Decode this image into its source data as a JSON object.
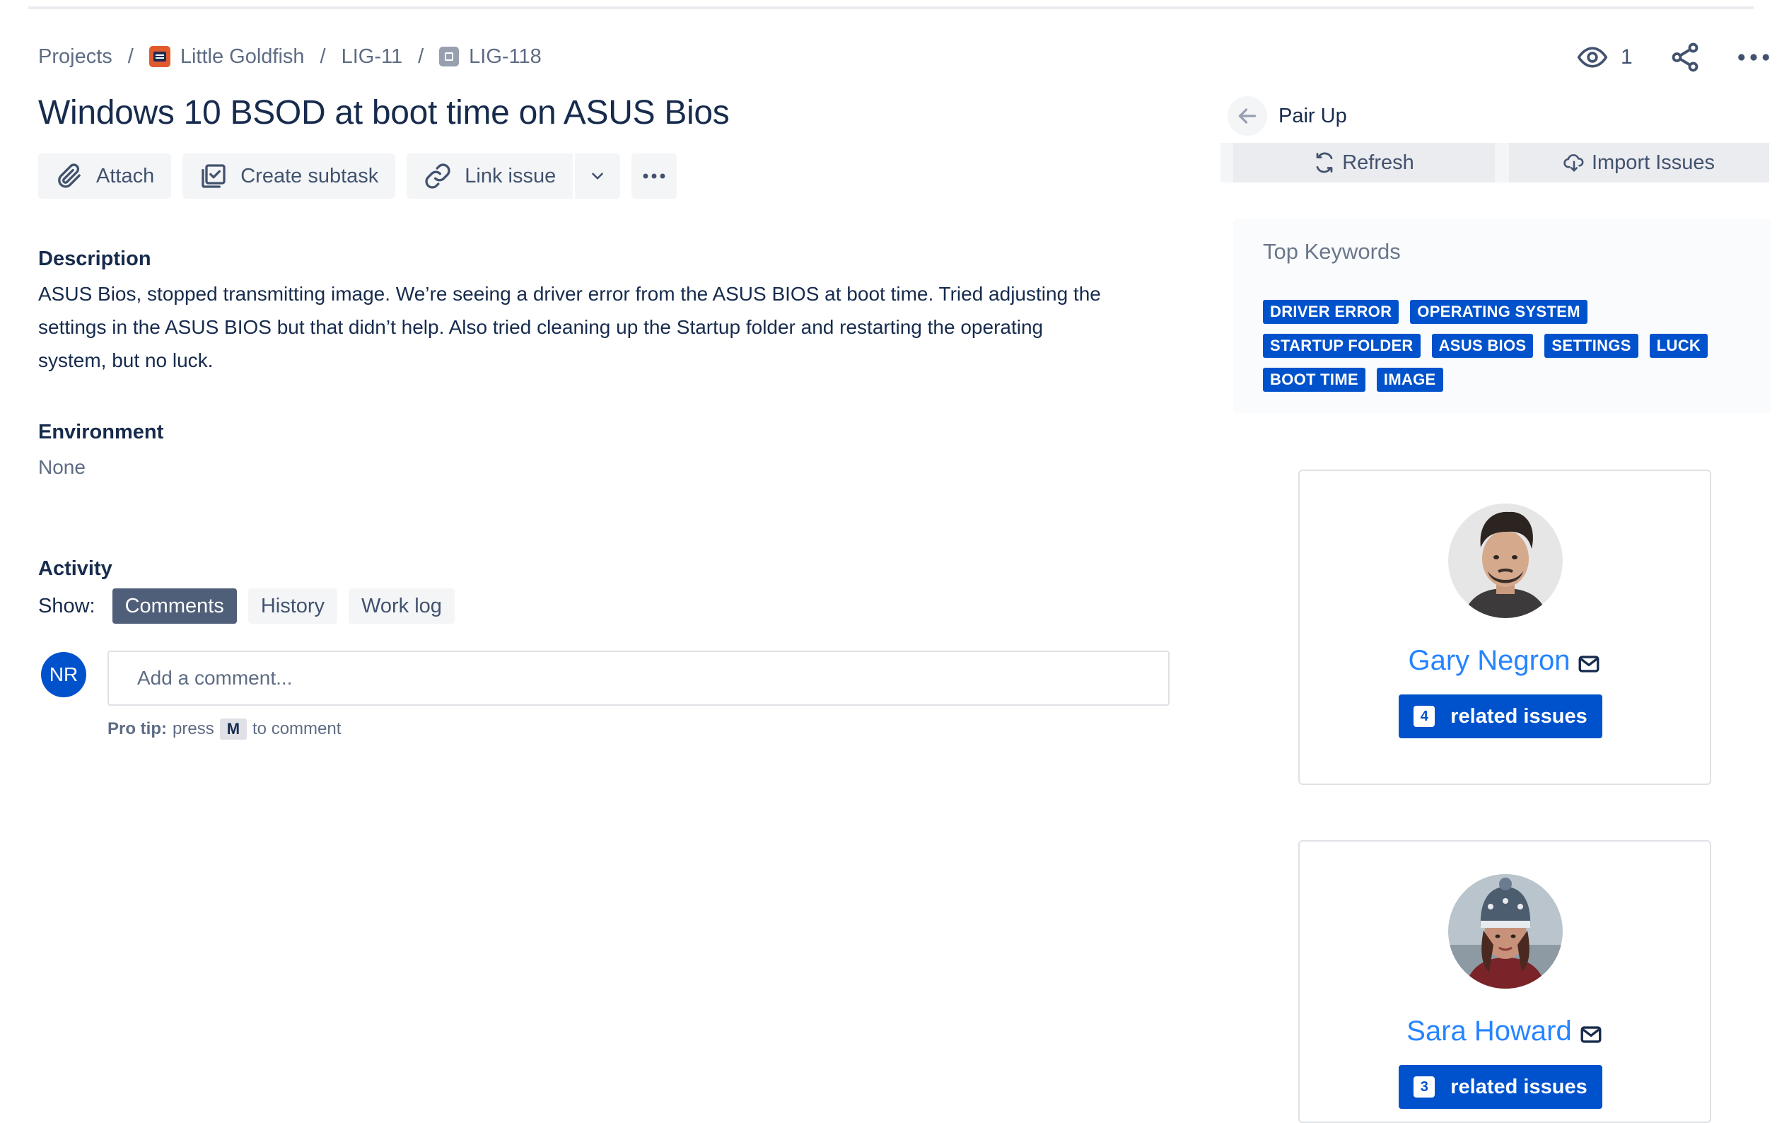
{
  "breadcrumb": {
    "projects": "Projects",
    "project": "Little Goldfish",
    "parent": "LIG-11",
    "issue": "LIG-118",
    "separator": "/"
  },
  "header": {
    "watch_count": "1",
    "watch_icon": "eye-icon",
    "share_icon": "share-icon",
    "more_icon": "more-icon"
  },
  "issue": {
    "title": "Windows 10 BSOD at boot time on ASUS Bios"
  },
  "toolbar": {
    "attach": "Attach",
    "create_subtask": "Create subtask",
    "link_issue": "Link issue"
  },
  "description": {
    "heading": "Description",
    "lines": [
      "ASUS Bios, stopped transmitting image. We’re seeing a driver error from the ASUS BIOS at boot time. Tried adjusting the",
      "settings in the ASUS BIOS but that didn’t help. Also tried cleaning up the Startup folder and restarting the operating",
      "system, but no luck."
    ]
  },
  "environment": {
    "heading": "Environment",
    "value": "None"
  },
  "activity": {
    "heading": "Activity",
    "show_label": "Show:",
    "tabs": [
      "Comments",
      "History",
      "Work log"
    ],
    "active_tab": "Comments",
    "user_initials": "NR",
    "comment_placeholder": "Add a comment...",
    "protip_label": "Pro tip:",
    "protip_press": "press",
    "protip_key": "M",
    "protip_suffix": "to comment"
  },
  "pair_up": {
    "title": "Pair Up",
    "refresh": "Refresh",
    "import": "Import Issues",
    "keywords_title": "Top Keywords",
    "keywords": [
      "DRIVER ERROR",
      "OPERATING SYSTEM",
      "STARTUP FOLDER",
      "ASUS BIOS",
      "SETTINGS",
      "LUCK",
      "BOOT TIME",
      "IMAGE"
    ],
    "people": [
      {
        "name": "Gary Negron",
        "related_count": "4",
        "related_label": "related issues"
      },
      {
        "name": "Sara Howard",
        "related_count": "3",
        "related_label": "related issues"
      }
    ]
  },
  "colors": {
    "primary": "#0052cc",
    "link": "#2684ff",
    "text": "#172b4d",
    "muted": "#5e6c84",
    "button_bg": "#f4f5f7",
    "active_tab": "#505f79",
    "project_icon": "#e15a2d"
  }
}
